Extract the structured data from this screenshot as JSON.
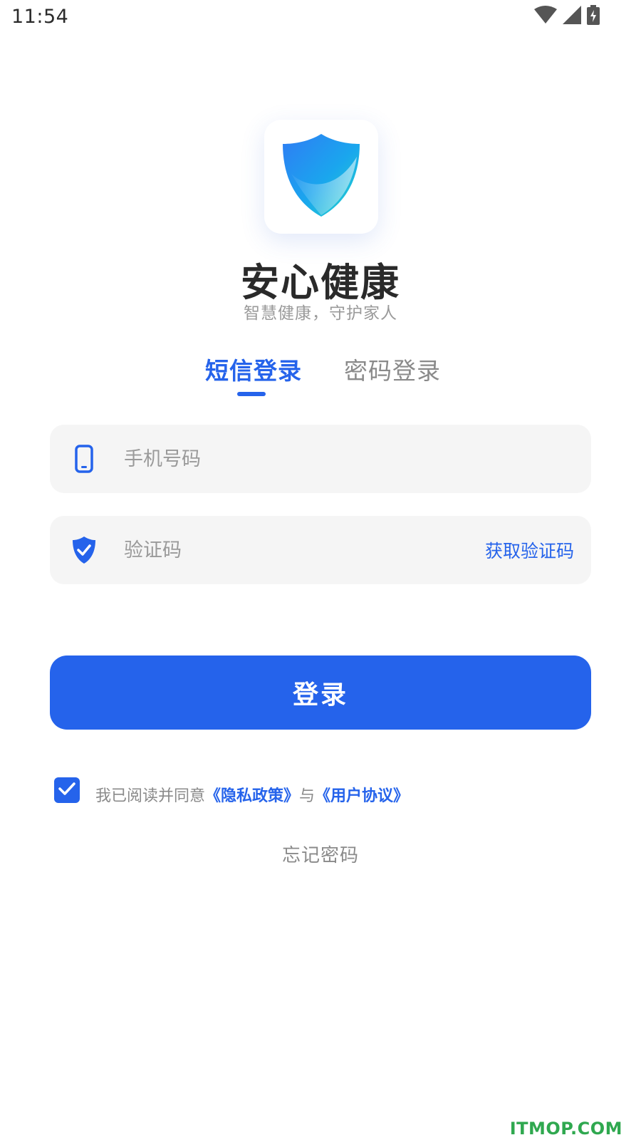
{
  "status_bar": {
    "time": "11:54"
  },
  "header": {
    "app_name": "安心健康",
    "slogan": "智慧健康，守护家人"
  },
  "tabs": [
    {
      "label": "短信登录",
      "active": true
    },
    {
      "label": "密码登录",
      "active": false
    }
  ],
  "form": {
    "phone": {
      "placeholder": "手机号码",
      "value": ""
    },
    "code": {
      "placeholder": "验证码",
      "value": "",
      "action_label": "获取验证码"
    }
  },
  "login_button": {
    "label": "登录"
  },
  "agreement": {
    "checked": true,
    "prefix": "我已阅读并同意",
    "privacy_link": "《隐私政策》",
    "conjunction": "与",
    "terms_link": "《用户协议》"
  },
  "forgot_password": "忘记密码",
  "watermark": "ITMOP.COM",
  "colors": {
    "primary": "#2563eb",
    "field_bg": "#f5f5f5",
    "text_dark": "#2a2a2a",
    "text_muted": "#9a9a9a",
    "watermark": "#2fa84f"
  },
  "icons": {
    "status": [
      "wifi-icon",
      "cellular-signal-icon",
      "battery-charging-icon"
    ],
    "logo": "shield-logo-icon",
    "phone_field": "phone-icon",
    "code_field": "shield-check-icon",
    "checkbox": "checkmark-icon"
  }
}
